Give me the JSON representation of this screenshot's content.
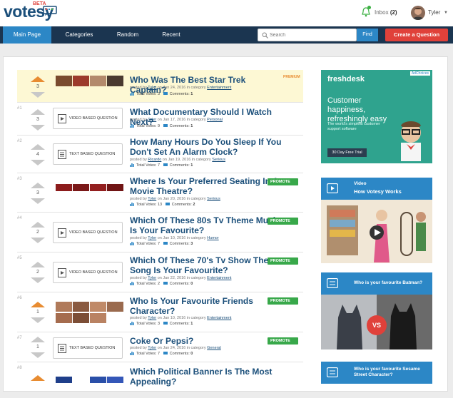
{
  "header": {
    "logo": "votesy",
    "beta": "BETA",
    "inbox_label": "Inbox",
    "inbox_count": "(2)",
    "username": "Tyler"
  },
  "nav": {
    "items": [
      "Main Page",
      "Categories",
      "Random",
      "Recent"
    ],
    "search_placeholder": "Search",
    "find_label": "Find",
    "create_label": "Create a Question"
  },
  "questions": [
    {
      "rank": "",
      "votes": "3",
      "title": "Who Was The Best Star Trek Captain?",
      "posted_by": "posted by",
      "author": "Tyler",
      "date": "on Jan 24, 2016 in category",
      "category": "Entertainment",
      "total_votes_label": "Total Votes:",
      "total_votes": "3",
      "comments_label": "Comments:",
      "comments": "1",
      "badge": "PREMIUM",
      "type": "images"
    },
    {
      "rank": "#1",
      "votes": "3",
      "title": "What Documentary Should I Watch Next?",
      "posted_by": "posted by",
      "author": "Tyler",
      "date": "on Jan 17, 2016 in category",
      "category": "Personal",
      "total_votes_label": "Total Votes:",
      "total_votes": "9",
      "comments_label": "Comments:",
      "comments": "1",
      "type_label": "VIDEO BASED QUESTION",
      "type": "video"
    },
    {
      "rank": "#2",
      "votes": "4",
      "title": "How Many Hours Do You Sleep If You Don't Set An Alarm Clock?",
      "posted_by": "posted by",
      "author": "Ricardo",
      "date": "on Jan 19, 2016 in category",
      "category": "Serious",
      "total_votes_label": "Total Votes:",
      "total_votes": "7",
      "comments_label": "Comments:",
      "comments": "1",
      "type_label": "TEXT BASED QUESTION",
      "type": "text"
    },
    {
      "rank": "#3",
      "votes": "3",
      "title": "Where Is Your Preferred Seating In A Movie Theatre?",
      "posted_by": "posted by",
      "author": "Tyler",
      "date": "on Jan 20, 2016 in category",
      "category": "Serious",
      "total_votes_label": "Total Votes:",
      "total_votes": "13",
      "comments_label": "Comments:",
      "comments": "2",
      "badge": "PROMOTE",
      "type": "images"
    },
    {
      "rank": "#4",
      "votes": "2",
      "title": "Which Of These 80s Tv Theme Music Is Your Favourite?",
      "posted_by": "posted by",
      "author": "Tyler",
      "date": "on Jan 10, 2016 in category",
      "category": "Humor",
      "total_votes_label": "Total Votes:",
      "total_votes": "7",
      "comments_label": "Comments:",
      "comments": "3",
      "badge": "PROMOTE",
      "type_label": "VIDEO BASED QUESTION",
      "type": "video"
    },
    {
      "rank": "#5",
      "votes": "2",
      "title": "Which Of These 70's Tv Show Theme Song Is Your Favourite?",
      "posted_by": "posted by",
      "author": "Tyler",
      "date": "on Jan 22, 2016 in category",
      "category": "Entertainment",
      "total_votes_label": "Total Votes:",
      "total_votes": "2",
      "comments_label": "Comments:",
      "comments": "0",
      "badge": "PROMOTE",
      "type_label": "VIDEO BASED QUESTION",
      "type": "video"
    },
    {
      "rank": "#6",
      "votes": "1",
      "title": "Who Is Your Favourite Friends Character?",
      "posted_by": "posted by",
      "author": "Tyler",
      "date": "on Jan 10, 2016 in category",
      "category": "Entertainment",
      "total_votes_label": "Total Votes:",
      "total_votes": "3",
      "comments_label": "Comments:",
      "comments": "1",
      "badge": "PROMOTE",
      "type": "images"
    },
    {
      "rank": "#7",
      "votes": "1",
      "title": "Coke Or Pepsi?",
      "posted_by": "posted by",
      "author": "Tyler",
      "date": "on Jan 24, 2016 in category",
      "category": "General",
      "total_votes_label": "Total Votes:",
      "total_votes": "7",
      "comments_label": "Comments:",
      "comments": "0",
      "badge": "PROMOTE",
      "type_label": "TEXT BASED QUESTION",
      "type": "text"
    },
    {
      "rank": "#8",
      "votes": "",
      "title": "Which Political Banner Is The Most Appealing?",
      "type": "images"
    }
  ],
  "ad": {
    "adchoices": "AdChoices",
    "brand": "freshdesk",
    "headline": "Customer happiness, refreshingly easy",
    "subline": "The world's simplest customer support software",
    "cta": "30 Day Free Trial"
  },
  "cards": [
    {
      "line1": "Video",
      "line2": "How Votesy Works"
    },
    {
      "line1": "Who is your favourite Batman?",
      "vs": "VS"
    },
    {
      "line1": "Who is your favourite Sesame Street Character?"
    }
  ],
  "colors": {
    "brand": "#1b4f7a",
    "nav_bg": "#1b3550",
    "accent": "#2c87c6",
    "cta": "#e0413a",
    "upvote": "#e88c31",
    "promote": "#38a84a"
  }
}
